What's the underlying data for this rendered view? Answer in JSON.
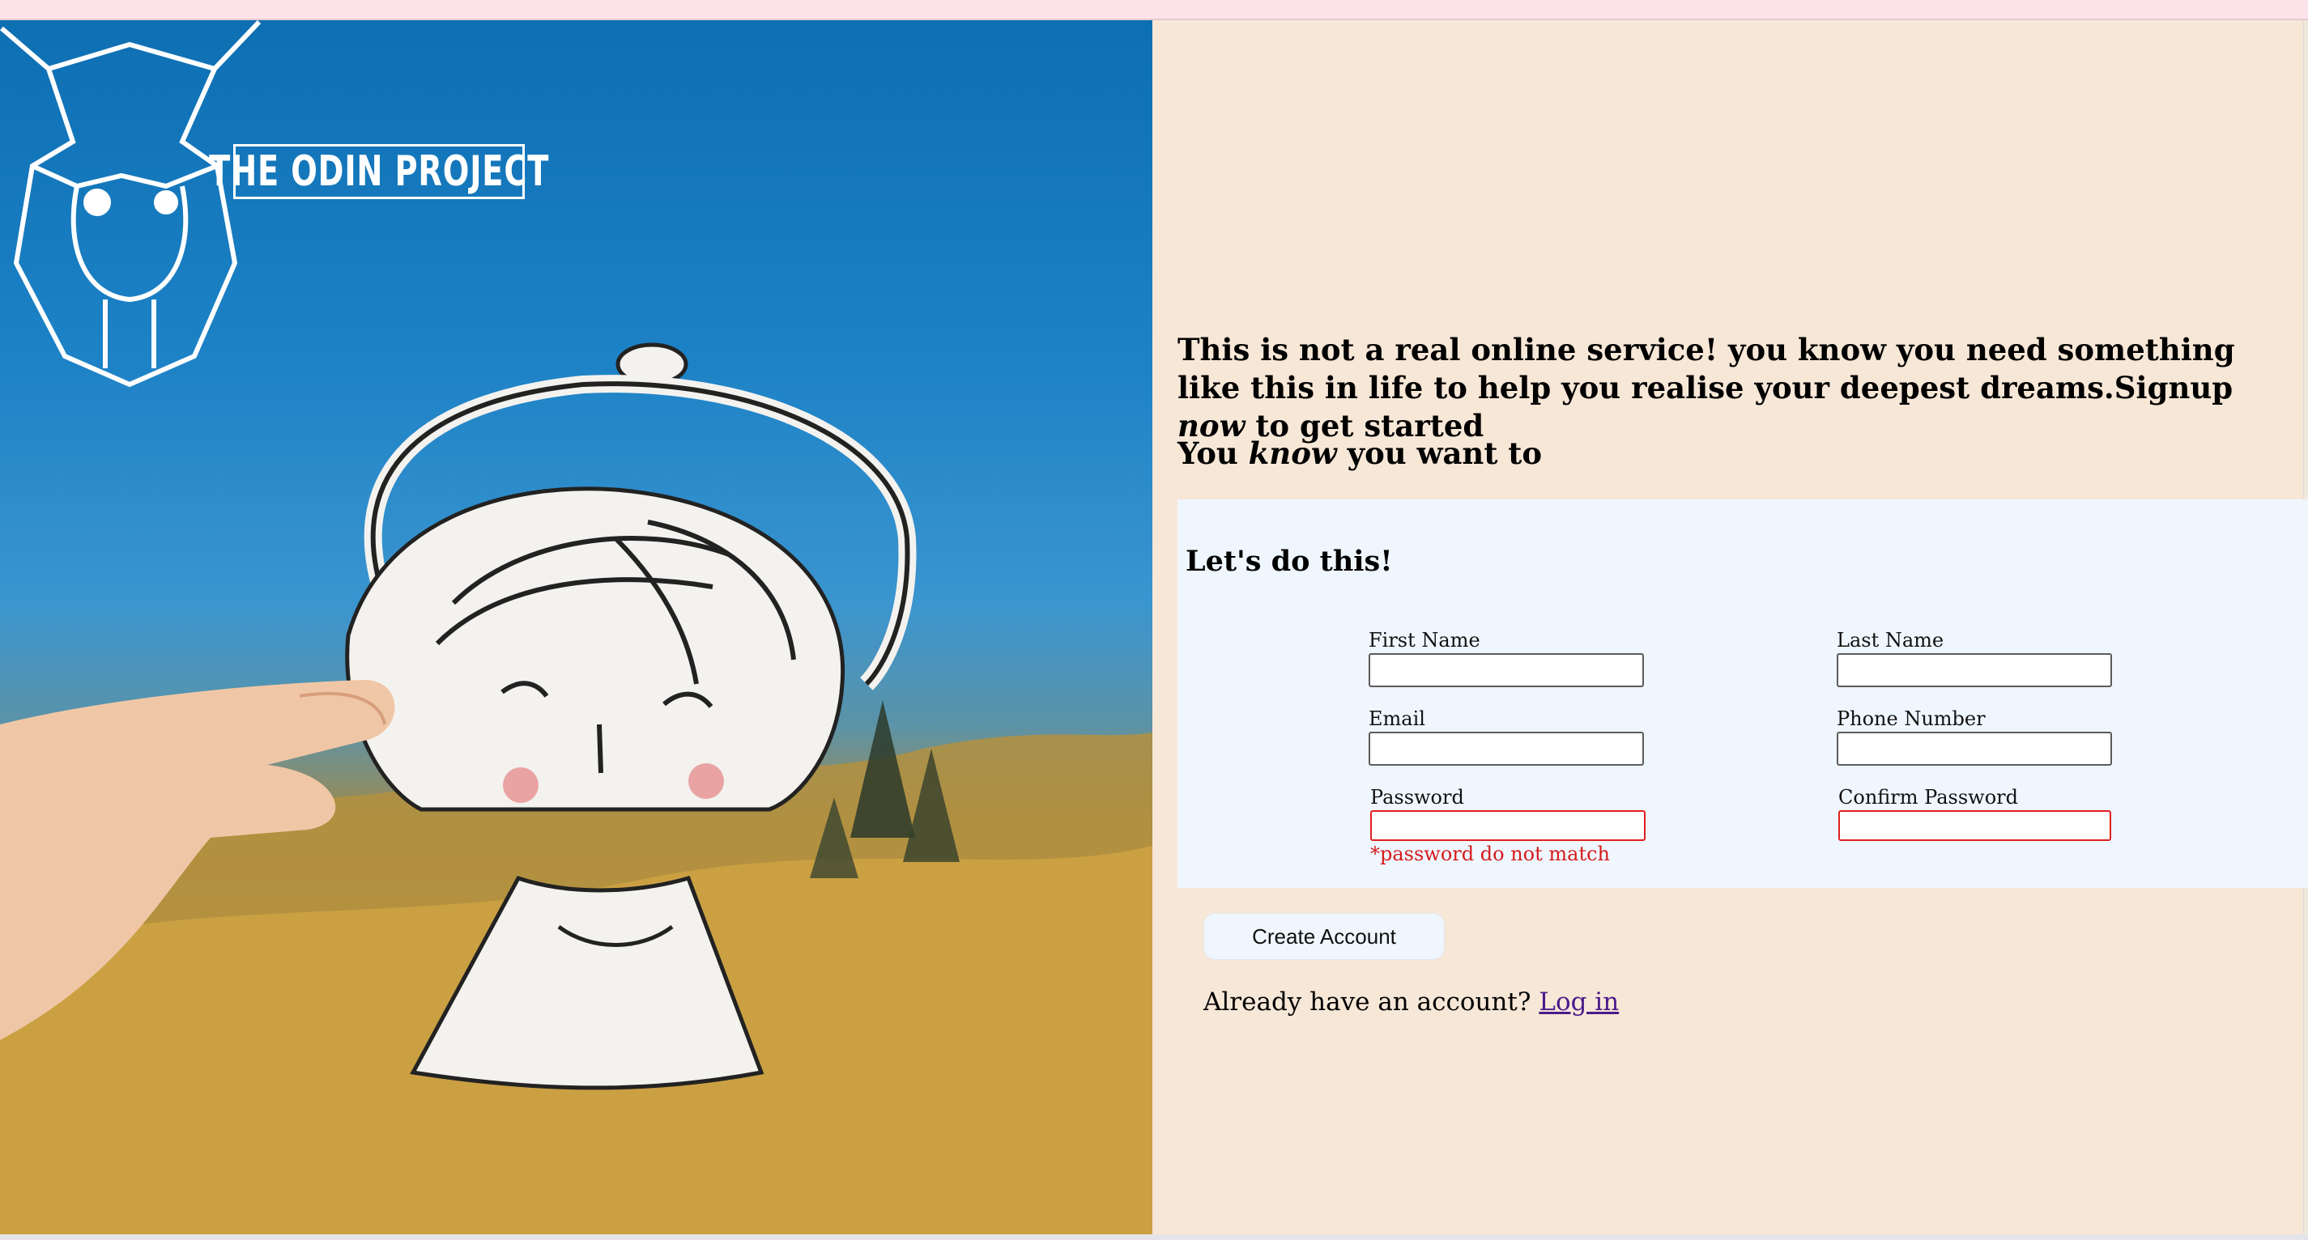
{
  "brand": {
    "name": "THE ODIN PROJECT",
    "logo_icon": "odin-viking-helmet-icon"
  },
  "hero": {
    "image": "paper-girl-cutout-held-against-sky-and-autumn-hills"
  },
  "intro": {
    "line_part1": "This is not a real online service! you know you need something like this in life to help you realise your deepest dreams.Signup ",
    "line_em": "now",
    "line_part2": " to get started"
  },
  "tagline": {
    "part1": "You ",
    "em": "know",
    "part2": " you want to"
  },
  "form": {
    "heading": "Let's do this!",
    "fields": {
      "first_name": {
        "label": "First Name",
        "value": ""
      },
      "last_name": {
        "label": "Last Name",
        "value": ""
      },
      "email": {
        "label": "Email",
        "value": ""
      },
      "phone": {
        "label": "Phone Number",
        "value": ""
      },
      "password": {
        "label": "Password",
        "value": "",
        "error": "*password do not match"
      },
      "confirm_password": {
        "label": "Confirm Password",
        "value": ""
      }
    }
  },
  "actions": {
    "create_label": "Create Account",
    "login_prompt": "Already have an account?",
    "login_link": "Log in"
  },
  "colors": {
    "page_bg": "#f7e7d7",
    "form_bg": "#eff6fe",
    "error": "#e02020",
    "link": "#4a1a8a"
  }
}
